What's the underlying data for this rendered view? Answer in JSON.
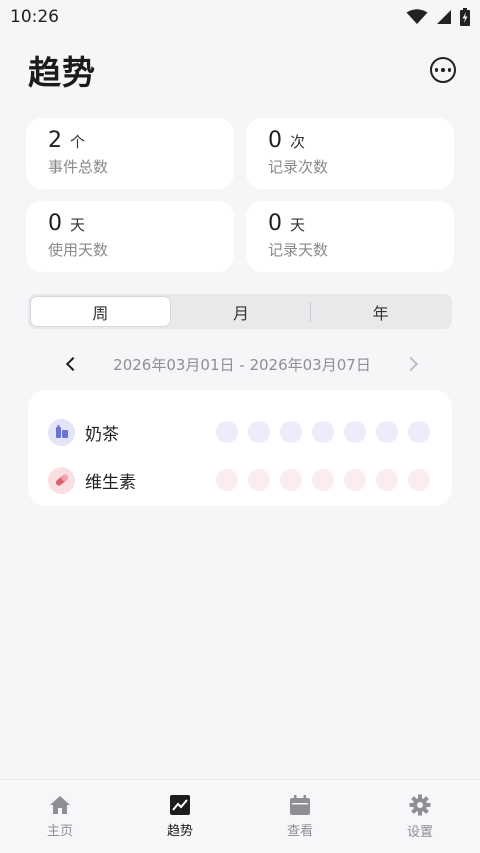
{
  "status_bar": {
    "time": "10:26",
    "icons": [
      "wifi-icon",
      "signal-icon",
      "battery-charging-icon"
    ]
  },
  "header": {
    "title": "趋势",
    "more_icon": "more-icon"
  },
  "stats": [
    {
      "value": "2",
      "unit": "个",
      "label": "事件总数"
    },
    {
      "value": "0",
      "unit": "次",
      "label": "记录次数"
    },
    {
      "value": "0",
      "unit": "天",
      "label": "使用天数"
    },
    {
      "value": "0",
      "unit": "天",
      "label": "记录天数"
    }
  ],
  "period_tabs": {
    "items": [
      "周",
      "月",
      "年"
    ],
    "selected": "周"
  },
  "date_range": {
    "text": "2026年03月01日 - 2026年03月07日"
  },
  "events": [
    {
      "name": "奶茶",
      "icon": "milk-tea-icon",
      "color": "#6b72d6",
      "dot_color": "#ececfb",
      "icon_bg": "#e3e4f8",
      "days_recorded": [
        false,
        false,
        false,
        false,
        false,
        false,
        false
      ]
    },
    {
      "name": "维生素",
      "icon": "pill-icon",
      "color": "#e0606f",
      "dot_color": "#fbecee",
      "icon_bg": "#f9dfe2",
      "days_recorded": [
        false,
        false,
        false,
        false,
        false,
        false,
        false
      ]
    }
  ],
  "tab_bar": {
    "items": [
      {
        "label": "主页",
        "icon": "home-icon"
      },
      {
        "label": "趋势",
        "icon": "trend-chart-icon"
      },
      {
        "label": "查看",
        "icon": "calendar-icon"
      },
      {
        "label": "设置",
        "icon": "gear-icon"
      }
    ],
    "active": "趋势"
  }
}
